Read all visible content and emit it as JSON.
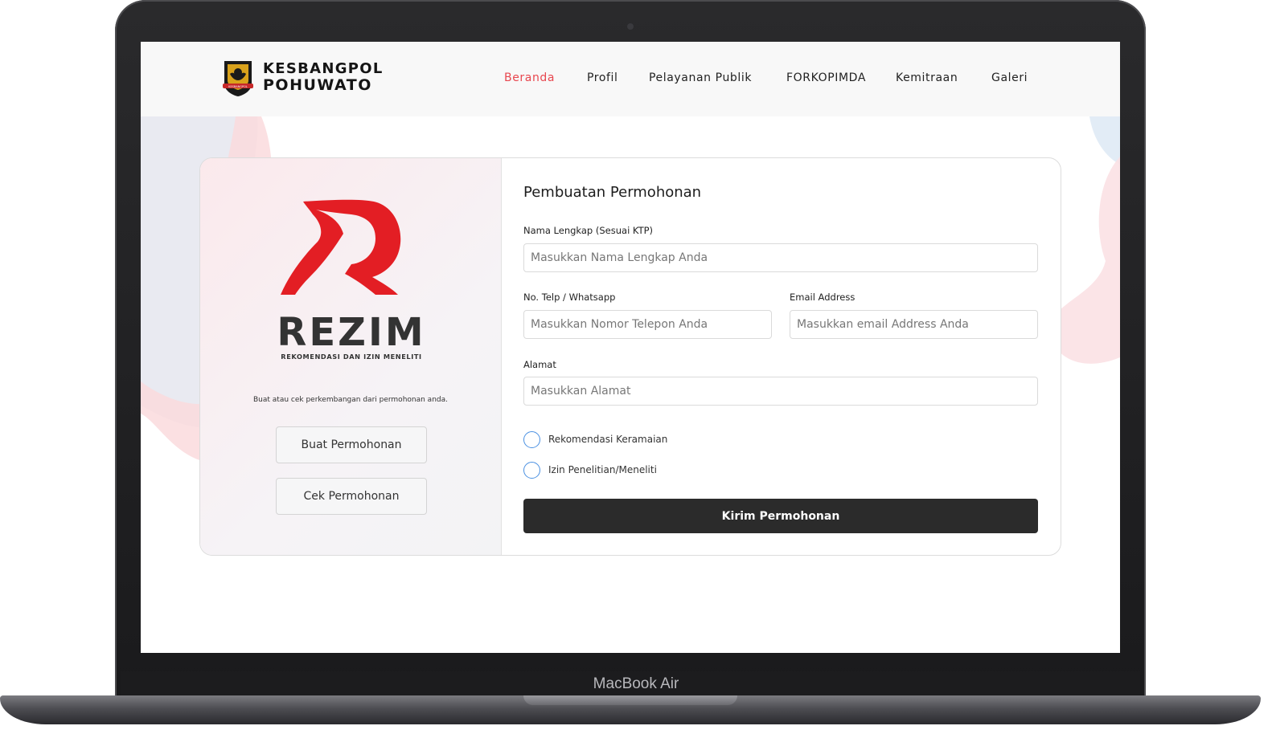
{
  "device": {
    "label": "MacBook Air"
  },
  "header": {
    "logo_line1": "KESBANGPOL",
    "logo_line2": "POHUWATO",
    "logo_emblem_text": "KESBANGPOL"
  },
  "nav": {
    "items": [
      {
        "label": "Beranda",
        "active": true
      },
      {
        "label": "Profil",
        "active": false
      },
      {
        "label": "Pelayanan Publik",
        "active": false
      },
      {
        "label": "FORKOPIMDA",
        "active": false
      },
      {
        "label": "Kemitraan",
        "active": false
      },
      {
        "label": "Galeri",
        "active": false
      }
    ],
    "active_color": "#e8474f"
  },
  "left_panel": {
    "brand_name": "REZIM",
    "brand_subtitle": "REKOMENDASI DAN IZIN MENELITI",
    "tagline": "Buat atau cek perkembangan dari permohonan anda.",
    "buttons": [
      "Buat Permohonan",
      "Cek Permohonan"
    ],
    "logo_color": "#e31e24"
  },
  "form": {
    "title": "Pembuatan Permohonan",
    "name": {
      "label": "Nama Lengkap (Sesuai KTP)",
      "placeholder": "Masukkan Nama Lengkap Anda",
      "value": ""
    },
    "phone": {
      "label": "No. Telp / Whatsapp",
      "placeholder": "Masukkan Nomor Telepon Anda",
      "value": ""
    },
    "email": {
      "label": "Email Address",
      "placeholder": "Masukkan email Address Anda",
      "value": ""
    },
    "address": {
      "label": "Alamat",
      "placeholder": "Masukkan Alamat",
      "value": ""
    },
    "options": [
      {
        "label": "Rekomendasi Keramaian",
        "checked": false
      },
      {
        "label": "Izin Penelitian/Meneliti",
        "checked": false
      }
    ],
    "submit_label": "Kirim Permohonan"
  }
}
